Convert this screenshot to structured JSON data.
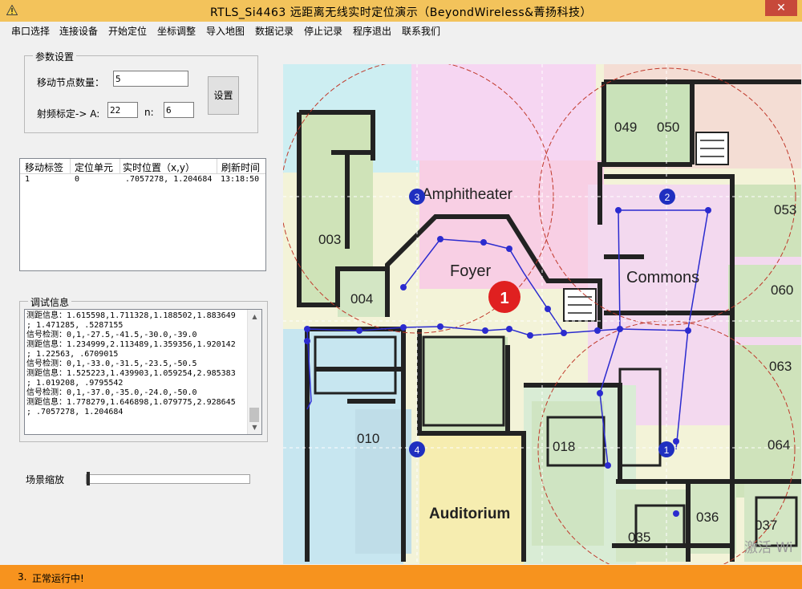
{
  "window": {
    "title": "RTLS_Si4463 远距离无线实时定位演示（BeyondWireless&菁扬科技）",
    "close_symbol": "✕"
  },
  "menu": [
    "串口选择",
    "连接设备",
    "开始定位",
    "坐标调整",
    "导入地图",
    "数据记录",
    "停止记录",
    "程序退出",
    "联系我们"
  ],
  "params": {
    "group_title": "参数设置",
    "node_count_label": "移动节点数量：",
    "node_count_value": "5",
    "rf_label": "射频标定-> A:",
    "a_value": "22",
    "n_label": "n:",
    "n_value": "6",
    "set_button": "设置"
  },
  "tag_table": {
    "columns": [
      "移动标签",
      "定位单元",
      "实时位置（x,y）",
      "刷新时间"
    ],
    "rows": [
      [
        "1",
        "0",
        ".7057278, 1.204684",
        "13:18:50"
      ]
    ]
  },
  "debug": {
    "group_title": "调试信息",
    "lines": [
      "测距信息：1.615598,1.711328,1.188502,1.883649",
      ";  1.471285, .5287155",
      "信号检测：0,1,-27.5,-41.5,-30.0,-39.0",
      "测距信息：1.234999,2.113489,1.359356,1.920142",
      ";  1.22563, .6709015",
      "信号检测：0,1,-33.0,-31.5,-23.5,-50.5",
      "测距信息：1.525223,1.439903,1.059254,2.985383",
      ";  1.019208, .9795542",
      "信号检测：0,1,-37.0,-35.0,-24.0,-50.0",
      "测距信息：1.778279,1.646898,1.079775,2.928645",
      ";  .7057278, 1.204684"
    ]
  },
  "zoom": {
    "label": "场景缩放",
    "level": 0.0
  },
  "map": {
    "rooms": [
      "049",
      "050",
      "053",
      "003",
      "004",
      "060",
      "063",
      "010",
      "018",
      "064",
      "036",
      "037",
      "035"
    ],
    "areas": [
      "Amphitheater",
      "Foyer",
      "Commons",
      "Auditorium"
    ],
    "anchors": [
      "3",
      "2",
      "4",
      "1"
    ],
    "tag": "1",
    "watermark": "激活 Wi"
  },
  "status": {
    "index": "3.",
    "text": "正常运行中!"
  },
  "colors": {
    "titlebar": "#f3c35b",
    "statusbar": "#f7931e",
    "anchor": "#1f2fc0",
    "tag": "#e02020",
    "path": "#2b2bcf"
  }
}
